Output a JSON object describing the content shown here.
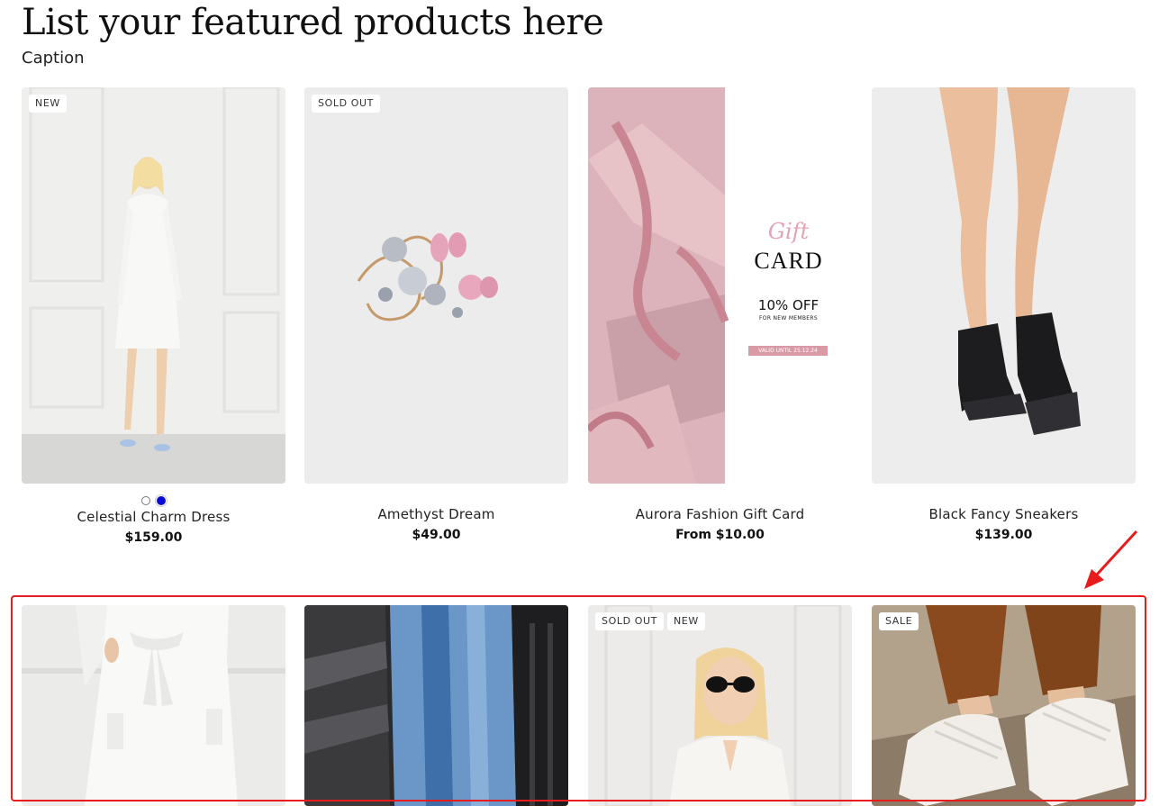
{
  "header": {
    "title": "List your featured products here",
    "caption": "Caption"
  },
  "rows": [
    [
      {
        "badges": [
          "NEW"
        ],
        "title": "Celestial Charm Dress",
        "price": "$159.00",
        "swatches": [
          "white",
          "blue"
        ]
      },
      {
        "badges": [
          "SOLD OUT"
        ],
        "title": "Amethyst Dream",
        "price": "$49.00"
      },
      {
        "badges": [],
        "title": "Aurora Fashion Gift Card",
        "price": "From $10.00",
        "image_text": {
          "script": "Gift",
          "heading": "CARD",
          "offer": "10% OFF",
          "sub": "FOR NEW MEMBERS",
          "valid": "VALID UNTIL 25.12.24"
        }
      },
      {
        "badges": [],
        "title": "Black Fancy Sneakers",
        "price": "$139.00"
      }
    ],
    [
      {
        "badges": []
      },
      {
        "badges": []
      },
      {
        "badges": [
          "SOLD OUT",
          "NEW"
        ]
      },
      {
        "badges": [
          "SALE"
        ]
      }
    ]
  ],
  "colors": {
    "highlight": "#e81c1c",
    "swatch_blue": "#0a0ad6",
    "gift_pink": "#d99aa6"
  }
}
